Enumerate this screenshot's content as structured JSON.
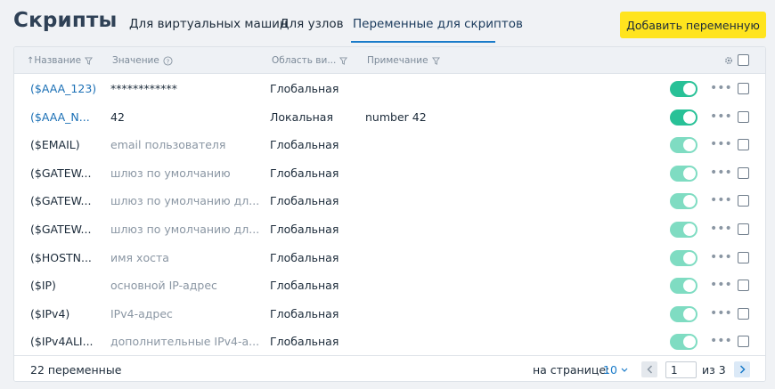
{
  "header": {
    "title": "Скрипты",
    "tabs": [
      {
        "label": "Для виртуальных машин",
        "active": false
      },
      {
        "label": "Для узлов",
        "active": false
      },
      {
        "label": "Переменные для скриптов",
        "active": true
      }
    ],
    "add_button": "Добавить переменную"
  },
  "table": {
    "columns": {
      "name": "Название",
      "value": "Значение",
      "scope": "Область ви...",
      "note": "Примечание"
    },
    "rows": [
      {
        "name": "($AAA_123)",
        "value": "************",
        "scope": "Глобальная",
        "note": "",
        "link": true,
        "muted": false,
        "enabled": true,
        "soft": false
      },
      {
        "name": "($AAA_N...",
        "value": "42",
        "scope": "Локальная",
        "note": "number 42",
        "link": true,
        "muted": false,
        "enabled": true,
        "soft": false
      },
      {
        "name": "($EMAIL)",
        "value": "email пользователя",
        "scope": "Глобальная",
        "note": "",
        "link": false,
        "muted": true,
        "enabled": true,
        "soft": true
      },
      {
        "name": "($GATEW...",
        "value": "шлюз по умолчанию",
        "scope": "Глобальная",
        "note": "",
        "link": false,
        "muted": true,
        "enabled": true,
        "soft": true
      },
      {
        "name": "($GATEW...",
        "value": "шлюз по умолчанию дл...",
        "scope": "Глобальная",
        "note": "",
        "link": false,
        "muted": true,
        "enabled": true,
        "soft": true
      },
      {
        "name": "($GATEW...",
        "value": "шлюз по умолчанию дл...",
        "scope": "Глобальная",
        "note": "",
        "link": false,
        "muted": true,
        "enabled": true,
        "soft": true
      },
      {
        "name": "($HOSTN...",
        "value": "имя хоста",
        "scope": "Глобальная",
        "note": "",
        "link": false,
        "muted": true,
        "enabled": true,
        "soft": true
      },
      {
        "name": "($IP)",
        "value": "основной IP-адрес",
        "scope": "Глобальная",
        "note": "",
        "link": false,
        "muted": true,
        "enabled": true,
        "soft": true
      },
      {
        "name": "($IPv4)",
        "value": "IPv4-адрес",
        "scope": "Глобальная",
        "note": "",
        "link": false,
        "muted": true,
        "enabled": true,
        "soft": true
      },
      {
        "name": "($IPv4ALI...",
        "value": "дополнительные IPv4-а...",
        "scope": "Глобальная",
        "note": "",
        "link": false,
        "muted": true,
        "enabled": true,
        "soft": true
      }
    ]
  },
  "footer": {
    "total": "22 переменные",
    "per_page_label": "на странице:",
    "per_page_value": "10",
    "current_page": "1",
    "of_label": "из",
    "total_pages": "3"
  },
  "colors": {
    "accent": "#1a7bc9",
    "button": "#ffe41e",
    "toggle_on": "#28c197",
    "toggle_soft": "#7fdcc2"
  }
}
